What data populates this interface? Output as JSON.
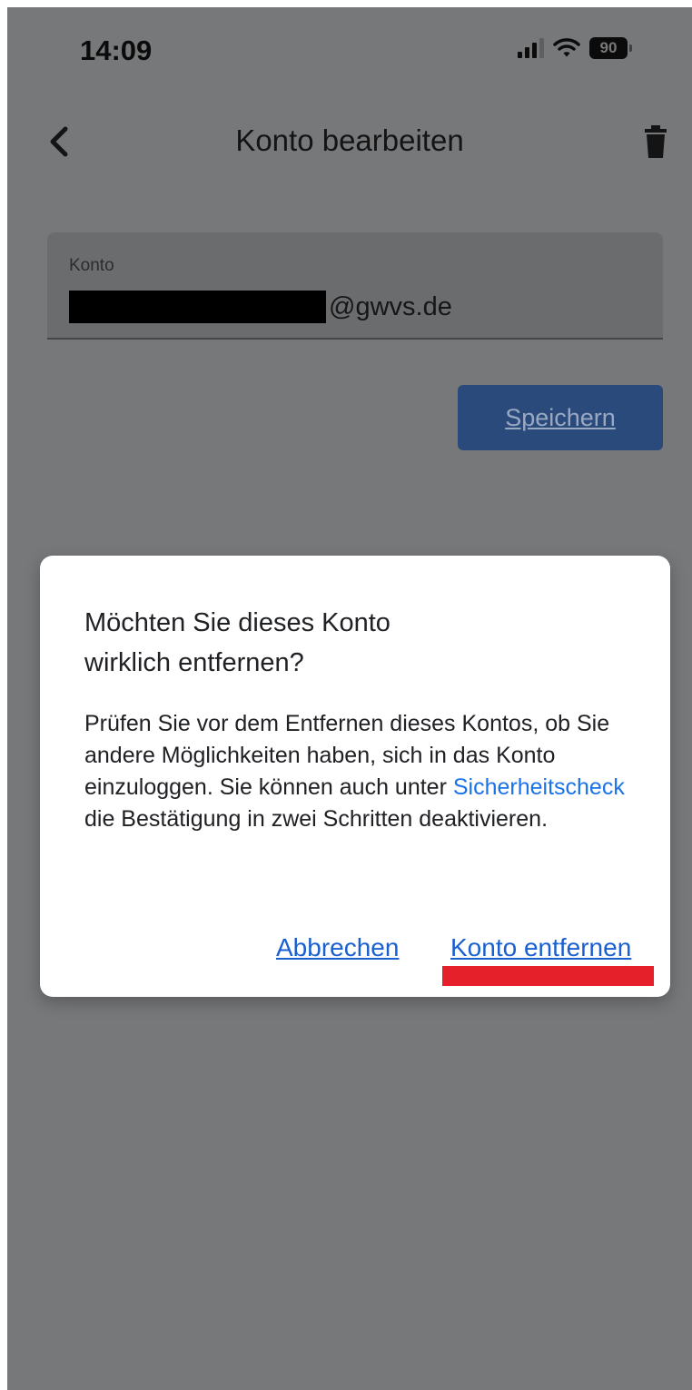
{
  "status_bar": {
    "time": "14:09",
    "battery": "90",
    "icons": [
      "signal-icon",
      "wifi-icon",
      "battery-icon"
    ]
  },
  "nav": {
    "title": "Konto bearbeiten",
    "back_icon": "chevron-left-icon",
    "delete_icon": "trash-icon"
  },
  "account_field": {
    "label": "Konto",
    "value_visible": "@gwvs.de"
  },
  "save_button": "Speichern",
  "dialog": {
    "title": "Möchten Sie dieses Konto wirklich entfernen?",
    "body_before_link": "Prüfen Sie vor dem Entfernen dieses Kontos, ob Sie andere Möglichkeiten haben, sich in das Konto einzuloggen. Sie können auch unter ",
    "link_text": "Sicherheitscheck",
    "body_after_link": " die Bestätigung in zwei Schritten deaktivieren.",
    "cancel_label": "Abbrechen",
    "confirm_label": "Konto entfernen"
  },
  "colors": {
    "overlay": "#77787a",
    "link": "#1a73e8",
    "highlight": "#e5202a",
    "save_button": "#2b4a7c"
  }
}
